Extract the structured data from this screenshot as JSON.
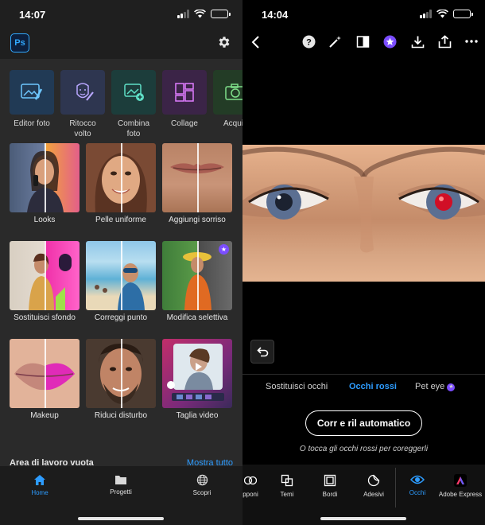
{
  "left": {
    "status": {
      "time": "14:07"
    },
    "app": {
      "logo": "Ps",
      "settings_icon": "gear-icon"
    },
    "tools": [
      {
        "label": "Editor foto",
        "icon": "photo-edit-icon",
        "color": "#213a55"
      },
      {
        "label": "Ritocco\nvolto",
        "icon": "face-retouch-icon",
        "color": "#2e3650"
      },
      {
        "label": "Combina\nfoto",
        "icon": "photo-combine-icon",
        "color": "#1c3d3b"
      },
      {
        "label": "Collage",
        "icon": "collage-icon",
        "color": "#3b2447"
      },
      {
        "label": "Acquis",
        "icon": "camera-icon",
        "color": "#233c26"
      }
    ],
    "features": [
      {
        "label": "Looks",
        "premium": false
      },
      {
        "label": "Pelle uniforme",
        "premium": false
      },
      {
        "label": "Aggiungi sorriso",
        "premium": false
      },
      {
        "label": "Sostituisci sfondo",
        "premium": false
      },
      {
        "label": "Correggi punto",
        "premium": false
      },
      {
        "label": "Modifica selettiva",
        "premium": true
      },
      {
        "label": "Makeup",
        "premium": false
      },
      {
        "label": "Riduci disturbo",
        "premium": false
      },
      {
        "label": "Taglia video",
        "premium": false
      }
    ],
    "workarea": {
      "title": "Area di lavoro vuota",
      "link": "Mostra tutto"
    },
    "tabs": [
      {
        "label": "Home",
        "icon": "home-icon",
        "active": true
      },
      {
        "label": "Progetti",
        "icon": "folder-icon",
        "active": false
      },
      {
        "label": "Scopri",
        "icon": "globe-icon",
        "active": false
      }
    ]
  },
  "right": {
    "status": {
      "time": "14:04"
    },
    "toolbar": [
      "back-icon",
      "help-icon",
      "magic-wand-icon",
      "compare-icon",
      "premium-star-icon",
      "download-icon",
      "share-icon",
      "more-icon"
    ],
    "subtabs": [
      {
        "label": "Sostituisci occhi",
        "active": false
      },
      {
        "label": "Occhi rossi",
        "active": true
      },
      {
        "label": "Pet eye",
        "active": false,
        "premium": true
      }
    ],
    "auto_button": "Corr e ril automatico",
    "hint": "O tocca gli occhi rossi per coreggerli",
    "bottom_tools": [
      {
        "label": "pponi",
        "icon": "layers-icon",
        "active": false
      },
      {
        "label": "Temi",
        "icon": "themes-icon",
        "active": false
      },
      {
        "label": "Bordi",
        "icon": "borders-icon",
        "active": false
      },
      {
        "label": "Adesivi",
        "icon": "stickers-icon",
        "active": false
      },
      {
        "label": "Occhi",
        "icon": "eye-icon",
        "active": true
      },
      {
        "label": "Adobe Express",
        "icon": "adobe-express-icon",
        "active": false
      }
    ]
  },
  "colors": {
    "accent": "#2d9cff",
    "premium": "#7b4dff"
  }
}
